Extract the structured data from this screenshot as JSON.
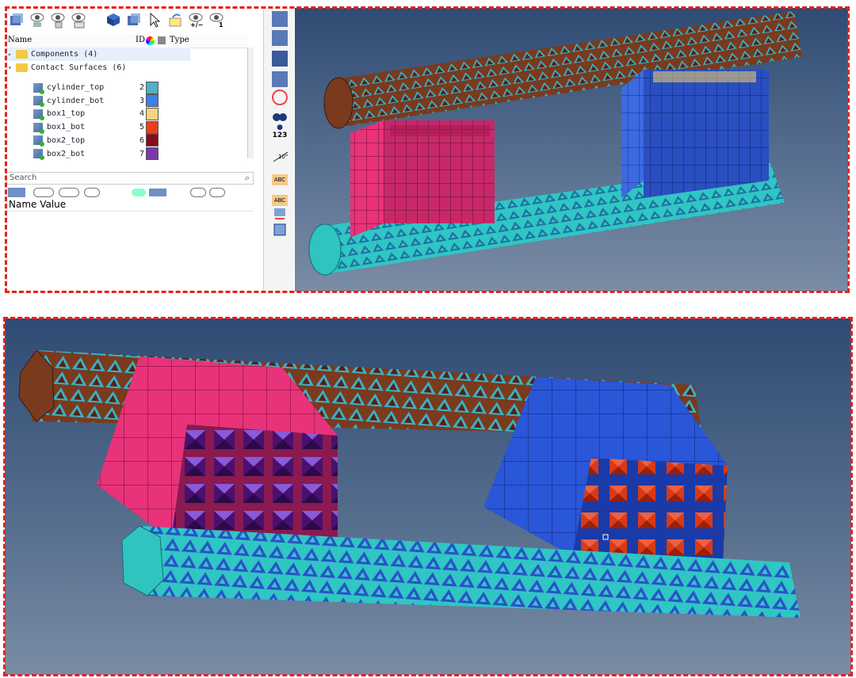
{
  "browser": {
    "columns": {
      "name": "Name",
      "id": "ID",
      "type": "Type"
    },
    "tree": [
      {
        "label": "Components (4)"
      },
      {
        "label": "Contact Surfaces (6)"
      }
    ],
    "surfaces": [
      {
        "label": "cylinder_top",
        "id": "2",
        "color": "#4fb0c6"
      },
      {
        "label": "cylinder_bot",
        "id": "3",
        "color": "#3f7fe6"
      },
      {
        "label": "box1_top",
        "id": "4",
        "color": "#f6d57a"
      },
      {
        "label": "box1_bot",
        "id": "5",
        "color": "#e8401c"
      },
      {
        "label": "box2_top",
        "id": "6",
        "color": "#8a0a1a"
      },
      {
        "label": "box2_bot",
        "id": "7",
        "color": "#7a3aa8"
      }
    ],
    "search_placeholder": "Search",
    "entity_editor": "Name Value"
  },
  "toolbar_badges": {
    "hide": "+/−",
    "show": "1",
    "number": "123",
    "abc1": "ABC",
    "abc2": "ABC"
  },
  "colors": {
    "cylinder_top": "#7a3a1e",
    "cylinder_bottom": "#2cc4c0",
    "box1": "#e8327a",
    "box2": "#2a56d8",
    "highlight": "#e8201e"
  }
}
